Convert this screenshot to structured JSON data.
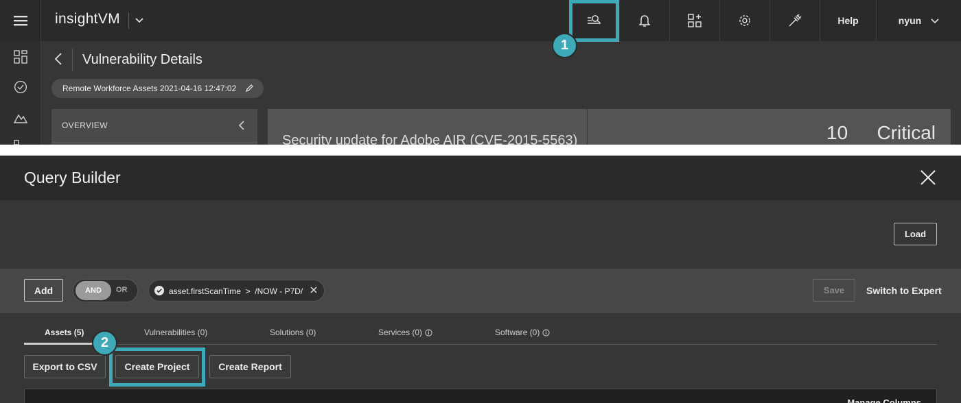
{
  "app": {
    "logo_text": "insightVM",
    "nav": {
      "help_label": "Help",
      "user_label": "nyun"
    }
  },
  "page": {
    "title": "Vulnerability Details",
    "scope_pill": "Remote Workforce Assets 2021-04-16 12:47:02",
    "overview_label": "OVERVIEW",
    "vuln_title": "Security update for Adobe AIR (CVE-2015-5563)",
    "risk_score": "10",
    "severity": "Critical"
  },
  "callouts": {
    "one": "1",
    "two": "2"
  },
  "query_builder": {
    "title": "Query Builder",
    "load_label": "Load",
    "add_label": "Add",
    "and_label": "AND",
    "or_label": "OR",
    "filter_chip": "asset.firstScanTime  >  /NOW - P7D/",
    "save_label": "Save",
    "switch_label": "Switch to Expert",
    "tabs": [
      {
        "label": "Assets (5)"
      },
      {
        "label": "Vulnerabilities (0)"
      },
      {
        "label": "Solutions (0)"
      },
      {
        "label": "Services (0)"
      },
      {
        "label": "Software (0)"
      }
    ],
    "actions": {
      "export_csv": "Export to CSV",
      "create_project": "Create Project",
      "create_report": "Create Report"
    },
    "manage_columns": "Manage Columns"
  },
  "colors": {
    "accent": "#3ea9b8",
    "navbar": "#2a2a2a",
    "panel": "#363636"
  }
}
